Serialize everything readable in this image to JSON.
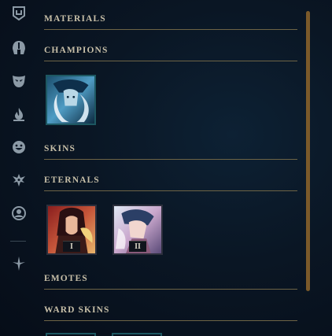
{
  "sidebar": {
    "icons": [
      {
        "name": "loot-tab-icon",
        "color": "#8c9aa6"
      },
      {
        "name": "champion-helmet-icon",
        "color": "#8c9aa6"
      },
      {
        "name": "skin-mask-icon",
        "color": "#8c9aa6"
      },
      {
        "name": "flame-icon",
        "color": "#8c9aa6"
      },
      {
        "name": "emote-face-icon",
        "color": "#8c9aa6"
      },
      {
        "name": "ward-icon",
        "color": "#8c9aa6"
      },
      {
        "name": "profile-icon",
        "color": "#8c9aa6"
      },
      {
        "name": "other-items-icon",
        "color": "#8c9aa6"
      }
    ]
  },
  "sections": {
    "materials": "MATERIALS",
    "champions": "CHAMPIONS",
    "skins": "SKINS",
    "eternals": "ETERNALS",
    "emotes": "EMOTES",
    "ward_skins": "WARD SKINS"
  },
  "eternals": {
    "tier1_label": "I",
    "tier2_label": "II"
  },
  "colors": {
    "header_text": "#c7bfa8",
    "rule": "#6e6446",
    "scrollbar": "#7b5a2a",
    "champion_tile_border": "#1d5761"
  }
}
